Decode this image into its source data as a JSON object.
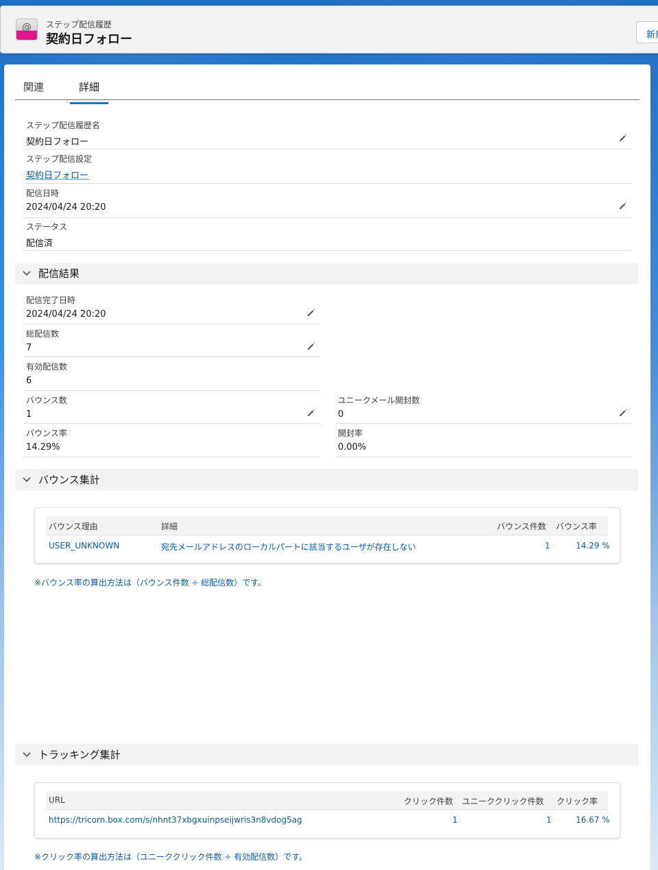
{
  "header": {
    "object_label": "ステップ配信履歴",
    "title": "契約日フォロー",
    "new_button": "新規"
  },
  "tabs": [
    {
      "label": "関連",
      "active": false
    },
    {
      "label": "詳細",
      "active": true
    }
  ],
  "fields": {
    "name": {
      "label": "ステップ配信履歴名",
      "value": "契約日フォロー"
    },
    "setting": {
      "label": "ステップ配信設定",
      "value": "契約日フォロー"
    },
    "datetime": {
      "label": "配信日時",
      "value": "2024/04/24 20:20"
    },
    "status": {
      "label": "ステータス",
      "value": "配信済"
    }
  },
  "delivery_result": {
    "title": "配信結果",
    "completed_at": {
      "label": "配信完了日時",
      "value": "2024/04/24 20:20"
    },
    "total": {
      "label": "総配信数",
      "value": "7"
    },
    "valid": {
      "label": "有効配信数",
      "value": "6"
    },
    "bounce_count": {
      "label": "バウンス数",
      "value": "1"
    },
    "unique_open": {
      "label": "ユニークメール開封数",
      "value": "0"
    },
    "bounce_rate": {
      "label": "バウンス率",
      "value": "14.29%"
    },
    "open_rate": {
      "label": "開封率",
      "value": "0.00%"
    }
  },
  "bounce_summary": {
    "title": "バウンス集計",
    "headers": [
      "バウンス理由",
      "詳細",
      "バウンス件数",
      "バウンス率"
    ],
    "rows": [
      {
        "reason": "USER_UNKNOWN",
        "detail": "宛先メールアドレスのローカルパートに該当するユーザが存在しない",
        "count": "1",
        "rate": "14.29 %"
      }
    ],
    "note": "※バウンス率の算出方法は（バウンス件数 ÷ 総配信数）です。"
  },
  "tracking_summary": {
    "title": "トラッキング集計",
    "headers": [
      "URL",
      "クリック件数",
      "ユニーククリック件数",
      "クリック率"
    ],
    "rows": [
      {
        "url": "https://tricorn.box.com/s/nhnt37xbgxuinpseijwris3n8vdog5ag",
        "clicks": "1",
        "unique_clicks": "1",
        "rate": "16.67 %"
      }
    ],
    "note": "※クリック率の算出方法は（ユニーククリック件数 ÷ 有効配信数）です。"
  },
  "colors": {
    "accent": "#0176d3",
    "link": "#0b5cab",
    "icon_pink": "#e4148a"
  }
}
